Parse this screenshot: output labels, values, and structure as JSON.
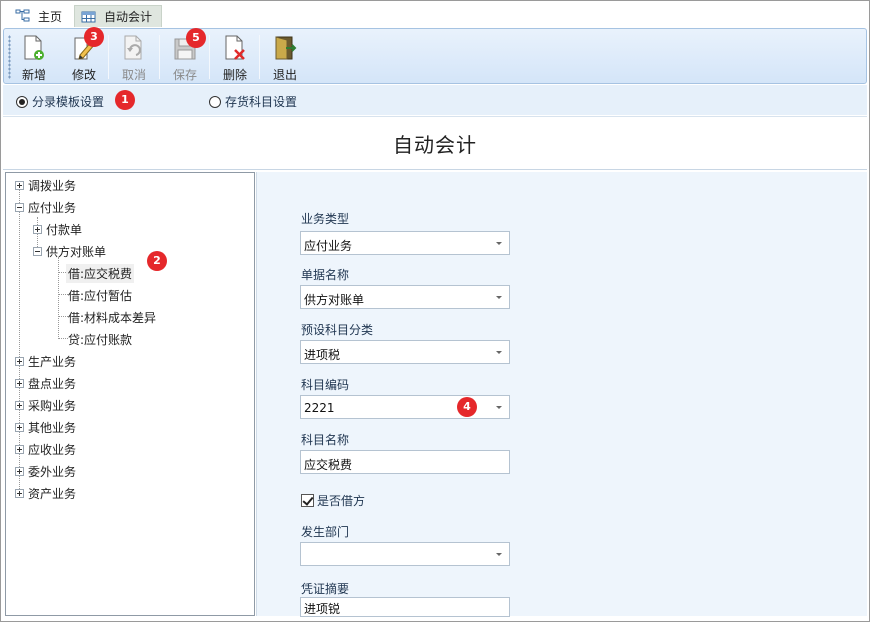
{
  "tabs": [
    {
      "label": "主页",
      "icon": "sitemap-icon"
    },
    {
      "label": "自动会计",
      "icon": "table-icon",
      "active": true
    }
  ],
  "toolbar": {
    "buttons": [
      {
        "label": "新增",
        "icon": "new-document-icon",
        "enabled": true
      },
      {
        "label": "修改",
        "icon": "edit-pencil-icon",
        "enabled": true
      },
      {
        "label": "取消",
        "icon": "undo-icon",
        "enabled": false
      },
      {
        "label": "保存",
        "icon": "save-disk-icon",
        "enabled": false
      },
      {
        "label": "删除",
        "icon": "delete-document-icon",
        "enabled": true
      },
      {
        "label": "退出",
        "icon": "exit-door-icon",
        "enabled": true
      }
    ]
  },
  "options": {
    "radio1": "分录模板设置",
    "radio2": "存货科目设置",
    "selected": "分录模板设置"
  },
  "title": "自动会计",
  "tree": {
    "n0": "调拨业务",
    "n1": "应付业务",
    "n2": "付款单",
    "n3": "供方对账单",
    "n4": "借:应交税费",
    "n5": "借:应付暂估",
    "n6": "借:材料成本差异",
    "n7": "贷:应付账款",
    "n8": "生产业务",
    "n9": "盘点业务",
    "n10": "采购业务",
    "n11": "其他业务",
    "n12": "应收业务",
    "n13": "委外业务",
    "n14": "资产业务",
    "selected": "借:应交税费"
  },
  "form": {
    "biz_type": {
      "label": "业务类型",
      "value": "应付业务"
    },
    "doc_name": {
      "label": "单据名称",
      "value": "供方对账单"
    },
    "subj_cat": {
      "label": "预设科目分类",
      "value": "进项税"
    },
    "subj_code": {
      "label": "科目编码",
      "value": "2221"
    },
    "subj_name": {
      "label": "科目名称",
      "value": "应交税费"
    },
    "is_debit": {
      "label": "是否借方",
      "checked": true
    },
    "dept": {
      "label": "发生部门",
      "value": ""
    },
    "summary": {
      "label": "凭证摘要",
      "value": "进项锐"
    }
  },
  "badges": {
    "b1": "1",
    "b2": "2",
    "b3": "3",
    "b4": "4",
    "b5": "5"
  },
  "colors": {
    "badge": "#e5282b",
    "toolbar": "#d4e5f8",
    "form_bg": "#eef5fc"
  }
}
